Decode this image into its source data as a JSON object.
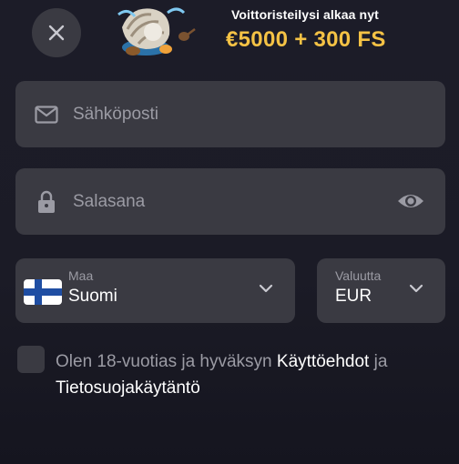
{
  "promo": {
    "subtitle": "Voittoristeilysi alkaa nyt",
    "amount": "€5000 + 300 FS"
  },
  "form": {
    "email": {
      "placeholder": "Sähköposti",
      "icon": "mail-icon"
    },
    "password": {
      "placeholder": "Salasana",
      "icon": "lock-icon",
      "toggle_icon": "eye-icon"
    },
    "country": {
      "label": "Maa",
      "value": "Suomi",
      "flag": "finland-flag"
    },
    "currency": {
      "label": "Valuutta",
      "value": "EUR"
    }
  },
  "consent": {
    "text_before": "Olen 18-vuotias ja hyväksyn",
    "terms_link": "Käyttöehdot",
    "conjunction": "ja",
    "privacy_link": "Tietosuojakäytäntö"
  },
  "colors": {
    "background": "#1c1c28",
    "field": "#3a3a42",
    "accent": "#f4c245",
    "muted_text": "#9b9ba4"
  }
}
